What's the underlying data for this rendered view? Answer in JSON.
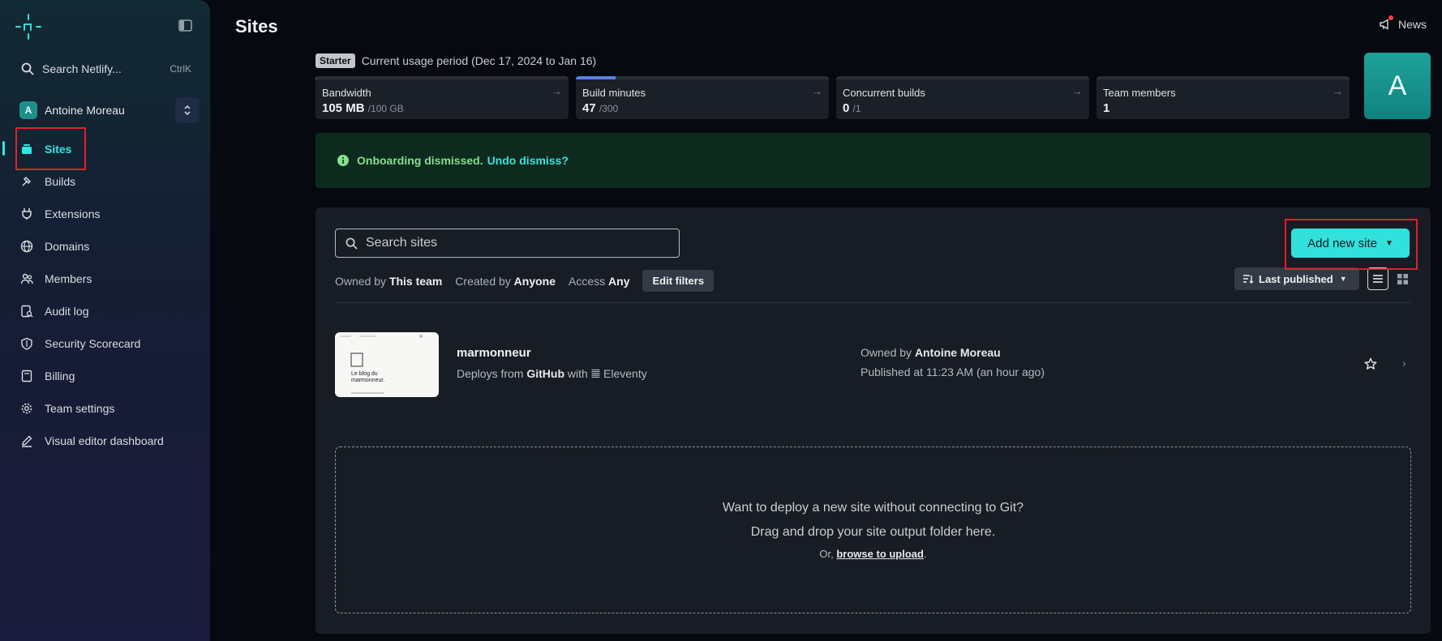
{
  "sidebar": {
    "search_label": "Search Netlify...",
    "search_shortcut": "CtrlK",
    "team_initial": "A",
    "team_name": "Antoine Moreau",
    "items": [
      {
        "label": "Sites",
        "icon": "sites-icon",
        "active": true
      },
      {
        "label": "Builds",
        "icon": "builds-icon"
      },
      {
        "label": "Extensions",
        "icon": "extensions-icon"
      },
      {
        "label": "Domains",
        "icon": "globe-icon"
      },
      {
        "label": "Members",
        "icon": "members-icon"
      },
      {
        "label": "Audit log",
        "icon": "audit-log-icon"
      },
      {
        "label": "Security Scorecard",
        "icon": "shield-icon"
      },
      {
        "label": "Billing",
        "icon": "billing-icon"
      },
      {
        "label": "Team settings",
        "icon": "gear-icon"
      },
      {
        "label": "Visual editor dashboard",
        "icon": "pencil-icon"
      }
    ]
  },
  "header": {
    "title": "Sites",
    "news_label": "News"
  },
  "usage": {
    "plan": "Starter",
    "period": "Current usage period (Dec 17, 2024 to Jan 16)",
    "cards": [
      {
        "name": "Bandwidth",
        "value": "105 MB",
        "limit": "/100 GB",
        "fraction": 0.001
      },
      {
        "name": "Build minutes",
        "value": "47",
        "limit": "/300",
        "fraction": 0.157
      },
      {
        "name": "Concurrent builds",
        "value": "0",
        "limit": "/1",
        "fraction": 0
      },
      {
        "name": "Team members",
        "value": "1",
        "limit": "",
        "fraction": 0
      }
    ],
    "avatar_initial": "A"
  },
  "banner": {
    "message": "Onboarding dismissed.",
    "undo_label": "Undo dismiss?"
  },
  "sites_panel": {
    "search_placeholder": "Search sites",
    "add_button_label": "Add new site",
    "filters": {
      "owned_prefix": "Owned by",
      "owned_value": "This team",
      "created_prefix": "Created by",
      "created_value": "Anyone",
      "access_prefix": "Access",
      "access_value": "Any",
      "edit_label": "Edit filters"
    },
    "sort_label": "Last published",
    "site": {
      "name": "marmonneur",
      "deploy_prefix": "Deploys from",
      "deploy_source": "GitHub",
      "deploy_with": "with",
      "framework": "Eleventy",
      "owner_prefix": "Owned by",
      "owner": "Antoine Moreau",
      "published": "Published at 11:23 AM (an hour ago)",
      "thumb_text": "Le blog du marmonneur."
    },
    "dropzone": {
      "line1": "Want to deploy a new site without connecting to Git?",
      "line2": "Drag and drop your site output folder here.",
      "line3_prefix": "Or,",
      "line3_link": "browse to upload",
      "line3_suffix": "."
    }
  },
  "colors": {
    "accent": "#32e0dc",
    "annotation_red": "#e0202b"
  }
}
